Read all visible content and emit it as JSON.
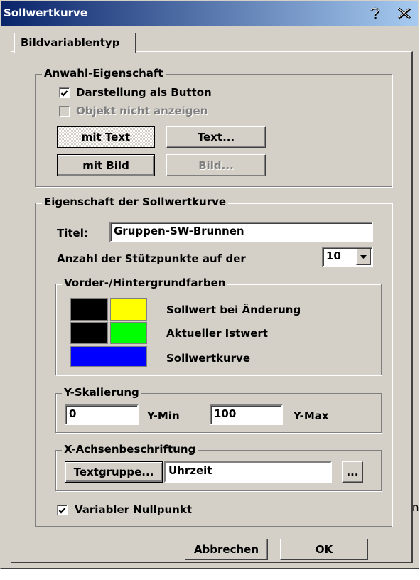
{
  "window": {
    "title": "Sollwertkurve"
  },
  "tab": {
    "label": "Bildvariablentyp"
  },
  "selection": {
    "group_label": "Anwahl-Eigenschaft",
    "as_button": {
      "label": "Darstellung als Button",
      "checked": true
    },
    "hide_object": {
      "label": "Objekt nicht anzeigen",
      "checked": false
    },
    "mit_text": "mit Text",
    "text_button": "Text...",
    "mit_bild": "mit Bild",
    "bild_button": "Bild..."
  },
  "curve": {
    "group_label": "Eigenschaft der Sollwertkurve",
    "title_label": "Titel:",
    "title_value": "Gruppen-SW-Brunnen",
    "points_label": "Anzahl der Stützpunkte auf der",
    "points_value": "10",
    "colors": {
      "group_label": "Vorder-/Hintergrundfarben",
      "rows": [
        {
          "label": "Sollwert bei Änderung",
          "fg": "#000000",
          "bg": "#ffff00"
        },
        {
          "label": "Aktueller Istwert",
          "fg": "#000000",
          "bg": "#00ff00"
        },
        {
          "label": "Sollwertkurve",
          "color": "#0000ff"
        }
      ]
    },
    "yscale": {
      "group_label": "Y-Skalierung",
      "min_value": "0",
      "min_label": "Y-Min",
      "max_value": "100",
      "max_label": "Y-Max"
    },
    "xaxis": {
      "group_label": "X-Achsenbeschriftung",
      "textgroup_button": "Textgruppe...",
      "value": "Uhrzeit",
      "browse_button": "..."
    },
    "variable_zero": {
      "label": "Variabler Nullpunkt",
      "checked": true
    }
  },
  "footer": {
    "cancel": "Abbrechen",
    "ok": "OK"
  },
  "background": {
    "stray_char": "n"
  }
}
